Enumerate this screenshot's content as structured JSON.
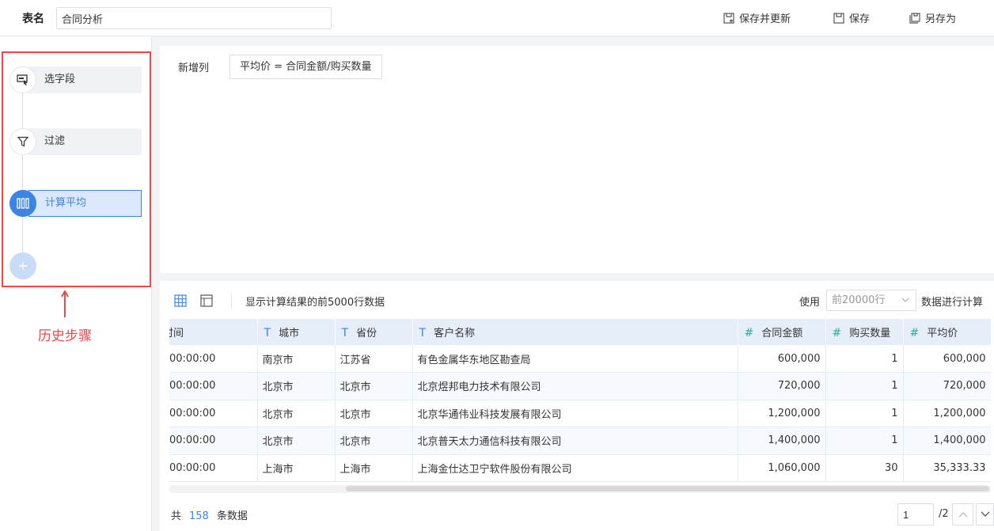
{
  "header": {
    "table_name_label": "表名",
    "table_name_value": "合同分析",
    "save_update_label": "保存并更新",
    "save_label": "保存",
    "save_as_label": "另存为"
  },
  "history": {
    "steps": [
      {
        "label": "选字段",
        "icon": "select-field-icon"
      },
      {
        "label": "过滤",
        "icon": "filter-icon"
      },
      {
        "label": "计算平均",
        "icon": "column-calc-icon"
      }
    ],
    "add_icon": "plus-icon",
    "annotation": "历史步骤",
    "annotation_color": "#e84a4a"
  },
  "formula": {
    "label": "新增列",
    "expression": "平均价 = 合同金额/购买数量"
  },
  "preview": {
    "text": "显示计算结果的前5000行数据",
    "use_label": "使用",
    "rows_option": "前20000行",
    "compute_label": "数据进行计算"
  },
  "table": {
    "columns": [
      {
        "label": "时间",
        "type": "none"
      },
      {
        "label": "城市",
        "type": "T"
      },
      {
        "label": "省份",
        "type": "T"
      },
      {
        "label": "客户名称",
        "type": "T"
      },
      {
        "label": "合同金额",
        "type": "#"
      },
      {
        "label": "购买数量",
        "type": "#"
      },
      {
        "label": "平均价",
        "type": "#"
      }
    ],
    "rows": [
      [
        "00:00:00",
        "南京市",
        "江苏省",
        "有色金属华东地区勘查局",
        "600,000",
        "1",
        "600,000"
      ],
      [
        "00:00:00",
        "北京市",
        "北京市",
        "北京煜邦电力技术有限公司",
        "720,000",
        "1",
        "720,000"
      ],
      [
        "00:00:00",
        "北京市",
        "北京市",
        "北京华通伟业科技发展有限公司",
        "1,200,000",
        "1",
        "1,200,000"
      ],
      [
        "00:00:00",
        "北京市",
        "北京市",
        "北京普天太力通信科技有限公司",
        "1,400,000",
        "1",
        "1,400,000"
      ],
      [
        "00:00:00",
        "上海市",
        "上海市",
        "上海金仕达卫宁软件股份有限公司",
        "1,060,000",
        "30",
        "35,333.33"
      ]
    ]
  },
  "footer": {
    "prefix": "共",
    "count": "158",
    "suffix": "条数据",
    "page_current": "1",
    "page_total": "/2"
  },
  "colors": {
    "accent": "#3b84e6",
    "number_type": "#2eab9e",
    "highlight_border": "#e84a4a"
  }
}
